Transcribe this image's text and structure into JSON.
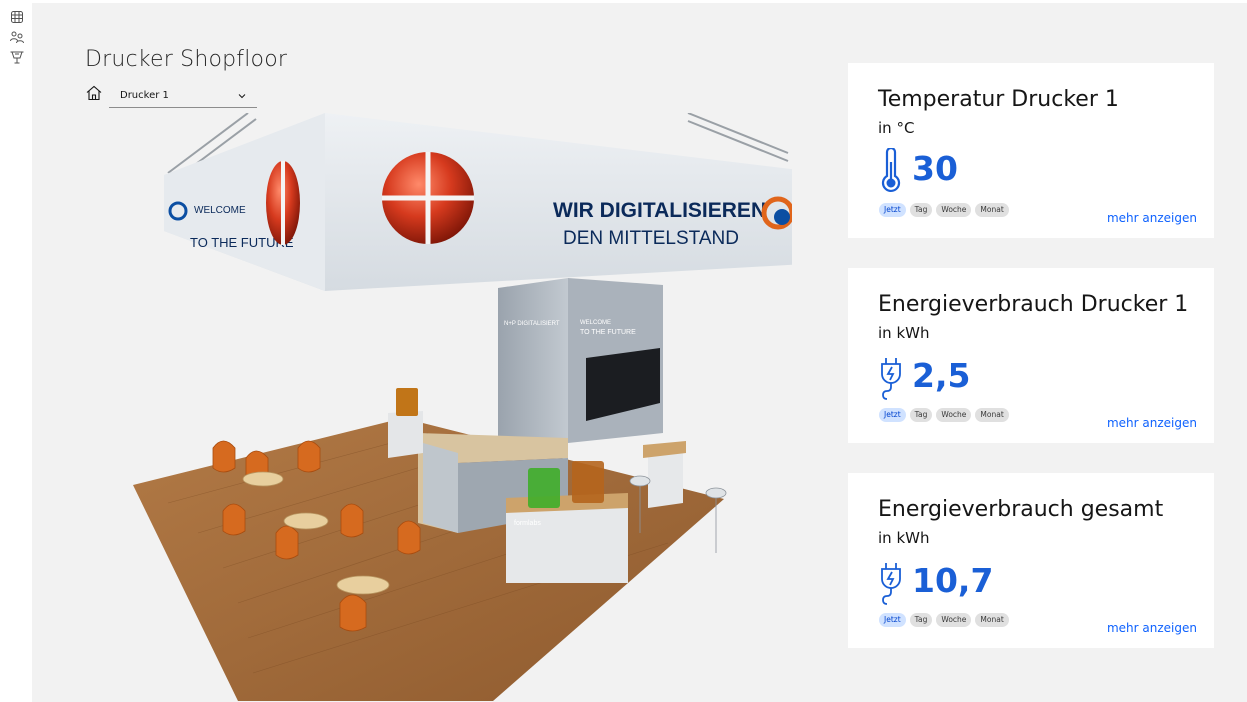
{
  "rail": {
    "items": [
      {
        "icon": "dashboard-icon"
      },
      {
        "icon": "users-icon"
      },
      {
        "icon": "printer-icon"
      }
    ]
  },
  "page": {
    "title": "Drucker Shopfloor"
  },
  "device_select": {
    "value": "Drucker 1"
  },
  "scene": {
    "banner_left_line1": "WELCOME",
    "banner_left_line2": "TO THE FUTURE",
    "banner_main_line1": "WIR DIGITALISIEREN",
    "banner_main_line2": "DEN MITTELSTAND",
    "column_text1": "N+P DIGITALISIERT",
    "column_text2": "WELCOME",
    "column_text3": "TO THE FUTURE",
    "counter_brand": "formlabs"
  },
  "cards": [
    {
      "title": "Temperatur Drucker 1",
      "unit": "in °C",
      "value": "30",
      "icon": "thermometer-icon",
      "chips": [
        "Jetzt",
        "Tag",
        "Woche",
        "Monat"
      ],
      "active_chip": "Jetzt",
      "link": "mehr anzeigen"
    },
    {
      "title": "Energieverbrauch Drucker 1",
      "unit": "in kWh",
      "value": "2,5",
      "icon": "plug-icon",
      "chips": [
        "Jetzt",
        "Tag",
        "Woche",
        "Monat"
      ],
      "active_chip": "Jetzt",
      "link": "mehr anzeigen"
    },
    {
      "title": "Energieverbrauch gesamt",
      "unit": "in kWh",
      "value": "10,7",
      "icon": "plug-icon",
      "chips": [
        "Jetzt",
        "Tag",
        "Woche",
        "Monat"
      ],
      "active_chip": "Jetzt",
      "link": "mehr anzeigen"
    }
  ],
  "colors": {
    "accent": "#1a5fd6",
    "link": "#0f62fe",
    "chip_active_bg": "#d0e2ff"
  }
}
